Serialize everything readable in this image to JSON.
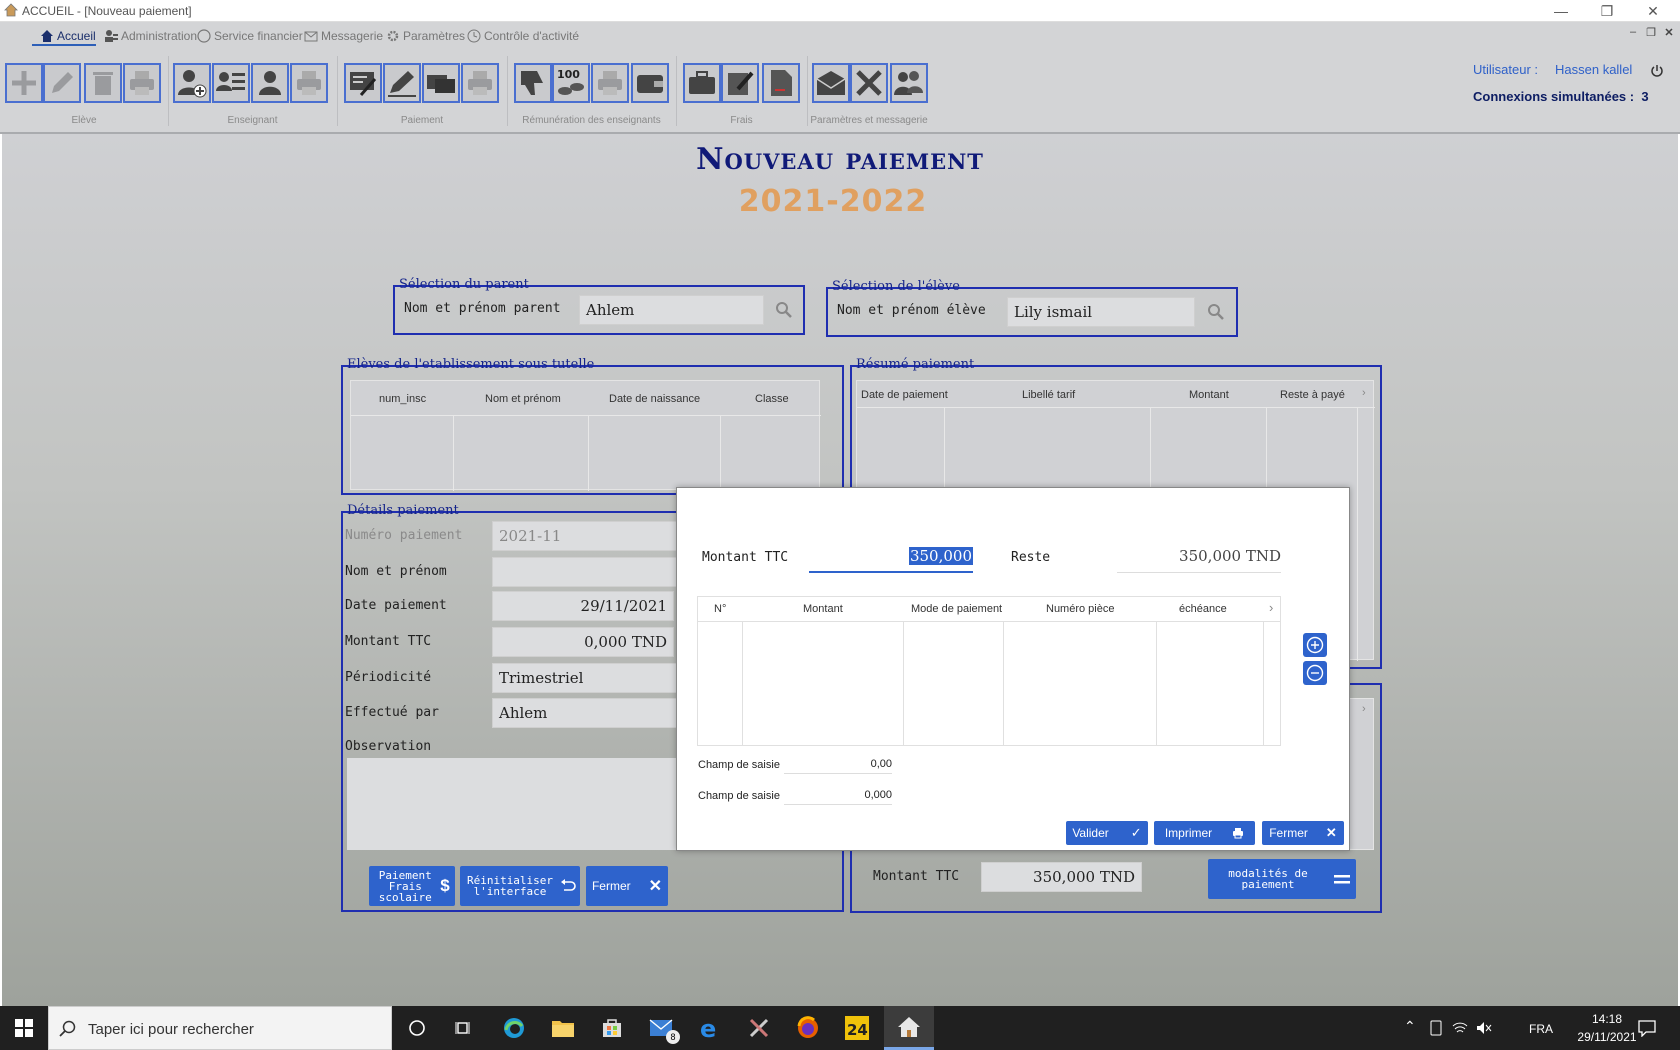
{
  "window": {
    "title": "ACCUEIL - [Nouveau paiement]"
  },
  "menu": [
    {
      "label": "Accueil",
      "icon": "home-icon"
    },
    {
      "label": "Administration",
      "icon": "admin-icon"
    },
    {
      "label": "Service financier",
      "icon": "finance-icon"
    },
    {
      "label": "Messagerie",
      "icon": "mail-icon"
    },
    {
      "label": "Paramètres",
      "icon": "gear-icon"
    },
    {
      "label": "Contrôle d'activité",
      "icon": "clock-icon"
    }
  ],
  "toolbar_groups": [
    "Elève",
    "Enseignant",
    "Paiement",
    "Rémunération des enseignants",
    "Frais",
    "Paramètres et messagerie"
  ],
  "user": {
    "label": "Utilisateur :",
    "name": "Hassen kallel",
    "connections_label": "Connexions simultanées :",
    "connections": "3"
  },
  "page": {
    "title": "Nouveau paiement",
    "year": "2021-2022"
  },
  "parent_select": {
    "legend": "Sélection du parent",
    "label": "Nom et prénom parent",
    "value": "Ahlem"
  },
  "eleve_select": {
    "legend": "Sélection de l'élève",
    "label": "Nom et prénom élève",
    "value": "Lily ismail"
  },
  "eleves_table": {
    "legend": "Elèves de l'etablissement  sous tutelle",
    "columns": [
      "num_insc",
      "Nom et prénom",
      "Date de naissance",
      "Classe"
    ]
  },
  "resume": {
    "legend": "Résumé paiement",
    "columns": [
      "Date de paiement",
      "Libellé tarif",
      "Montant",
      "Reste à payé"
    ]
  },
  "details": {
    "legend": "Détails paiement",
    "numero_label": "Numéro paiement",
    "numero_value": "2021-11",
    "nom_label": "Nom et prénom",
    "nom_value": "",
    "date_label": "Date paiement",
    "date_value": "29/11/2021",
    "montant_label": "Montant TTC",
    "montant_value": "0,000 TND",
    "periodicite_label": "Périodicité",
    "periodicite_value": "Trimestriel",
    "effectue_label": "Effectué par",
    "effectue_value": "Ahlem",
    "observation_label": "Observation"
  },
  "bottom_buttons": {
    "paiement": "Paiement Frais scolaire",
    "reinit": "Réinitialiser l'interface",
    "fermer": "Fermer"
  },
  "right_bottom": {
    "montant_label": "Montant TTC",
    "montant_value": "350,000 TND",
    "modalites": "modalités de paiement"
  },
  "dialog": {
    "montant_label": "Montant TTC",
    "montant_value": "350,000",
    "reste_label": "Reste",
    "reste_value": "350,000 TND",
    "columns": [
      "N°",
      "Montant",
      "Mode de paiement",
      "Numéro pièce",
      "échéance"
    ],
    "champ1_label": "Champ de saisie",
    "champ1_value": "0,00",
    "champ2_label": "Champ de saisie",
    "champ2_value": "0,000",
    "valider": "Valider",
    "imprimer": "Imprimer",
    "fermer": "Fermer"
  },
  "taskbar": {
    "search_placeholder": "Taper ici pour rechercher",
    "lang": "FRA",
    "time": "14:18",
    "date": "29/11/2021",
    "mail_badge": "8"
  },
  "colors": {
    "accent": "#2e63cc",
    "frame": "#1f2eb0",
    "title": "#101a78",
    "year": "#e0a060"
  }
}
